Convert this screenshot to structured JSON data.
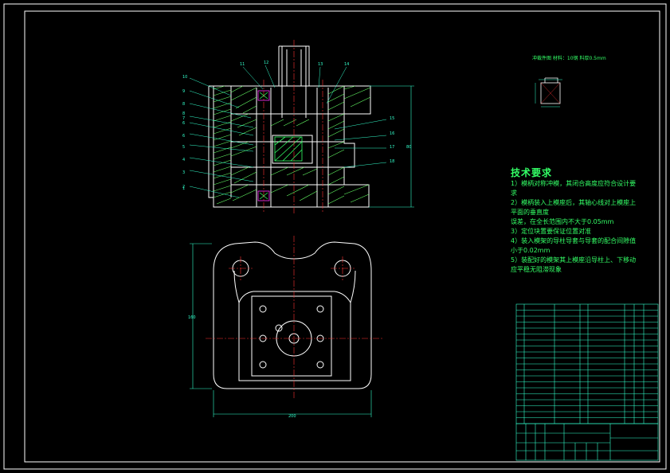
{
  "drawing": {
    "colors": {
      "background": "#000000",
      "frame": "#ffffff",
      "geometry": "#ffffff",
      "centerline": "#ff3333",
      "dimension": "#33ffcc",
      "hatch": "#66ff66",
      "section": "#33ff66",
      "leader": "#33ffcc",
      "note_text": "#33ff66",
      "highlight": "#ff33ff",
      "table": "#33ffcc"
    },
    "part_header": "冲裁件图    材料：10钢    料厚0.5mm",
    "section_labels": [
      "10",
      "9",
      "8",
      "8",
      "7",
      "6",
      "6",
      "5",
      "4",
      "3",
      "2",
      "1"
    ],
    "section_top_labels": [
      "11",
      "12",
      "13",
      "14"
    ],
    "section_right_labels": [
      "15",
      "16",
      "17",
      "18"
    ],
    "dim_height": "80",
    "dim_width": "200",
    "dim_depth": "160",
    "tech_req": {
      "title": "技术要求",
      "lines": [
        "1）模柄对称冲模，其闭合高度应符合设计要",
        "求",
        "2）模柄装入上模座后，其轴心线对上模座上",
        "平面的垂直度",
        "   误差，在全长范围内不大于0.05mm",
        "3）定位块置要保证位置对准",
        "4）装入模架的导柱导套与导套的配合间隙值",
        "小于0.02mm",
        "5）装配好的模架其上模座沿导柱上、下移动",
        "应平稳无阻滞现象"
      ]
    }
  }
}
